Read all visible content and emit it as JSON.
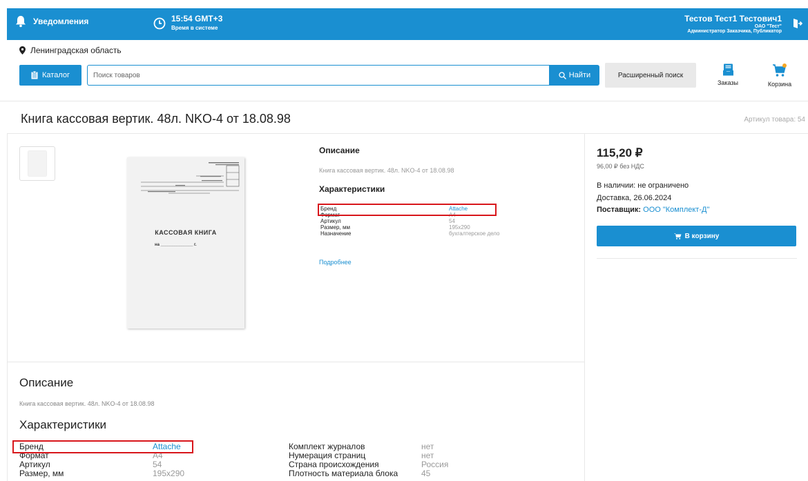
{
  "header": {
    "notifications_label": "Уведомления",
    "time": "15:54 GMT+3",
    "time_caption": "Время в системе",
    "user_name": "Тестов Тест1 Тестович1",
    "organization": "ОАО \"Тест\"",
    "roles": "Администратор Заказчика, Публикатор"
  },
  "location": "Ленинградская область",
  "search": {
    "catalog_label": "Каталог",
    "placeholder": "Поиск товаров",
    "find_label": "Найти",
    "advanced_label": "Расширенный поиск"
  },
  "nav": {
    "orders_label": "Заказы",
    "cart_label": "Корзина"
  },
  "product": {
    "title": "Книга кассовая вертик. 48л. NKO-4 от 18.08.98",
    "sku_label": "Артикул товара: 54",
    "image_text": {
      "title": "КАССОВАЯ КНИГА",
      "line": "на ______________ г."
    },
    "description_heading": "Описание",
    "description_text": "Книга кассовая вертик. 48л. NKO-4 от 18.08.98",
    "characteristics_heading": "Характеристики",
    "characteristics": [
      {
        "key": "Бренд",
        "value": "Attache"
      },
      {
        "key": "Формат",
        "value": "А4"
      },
      {
        "key": "Артикул",
        "value": "54"
      },
      {
        "key": "Размер, мм",
        "value": "195x290"
      },
      {
        "key": "Назначение",
        "value": "бухгалтерское дело"
      }
    ],
    "more_link": "Подробнее"
  },
  "purchase": {
    "price": "115,20 ₽",
    "price_no_vat": "96,00 ₽ без НДС",
    "stock": "В наличии: не ограничено",
    "delivery": "Доставка, 26.06.2024",
    "supplier_label": "Поставщик:",
    "supplier_name": "ООО \"Комплект-Д\"",
    "cart_button": "В корзину"
  },
  "details": {
    "description_heading": "Описание",
    "description_text": "Книга кассовая вертик. 48л. NKO-4 от 18.08.98",
    "characteristics_heading": "Характеристики",
    "col1": [
      {
        "key": "Бренд",
        "value": "Attache"
      },
      {
        "key": "Формат",
        "value": "А4"
      },
      {
        "key": "Артикул",
        "value": "54"
      },
      {
        "key": "Размер, мм",
        "value": "195x290"
      }
    ],
    "col2": [
      {
        "key": "Комплект журналов",
        "value": "нет"
      },
      {
        "key": "Нумерация страниц",
        "value": "нет"
      },
      {
        "key": "Страна происхождения",
        "value": "Россия"
      },
      {
        "key": "Плотность материала блока",
        "value": "45"
      }
    ]
  },
  "colors": {
    "accent": "#1a8fd1",
    "highlight": "#d8161b",
    "muted_text": "#999999"
  }
}
